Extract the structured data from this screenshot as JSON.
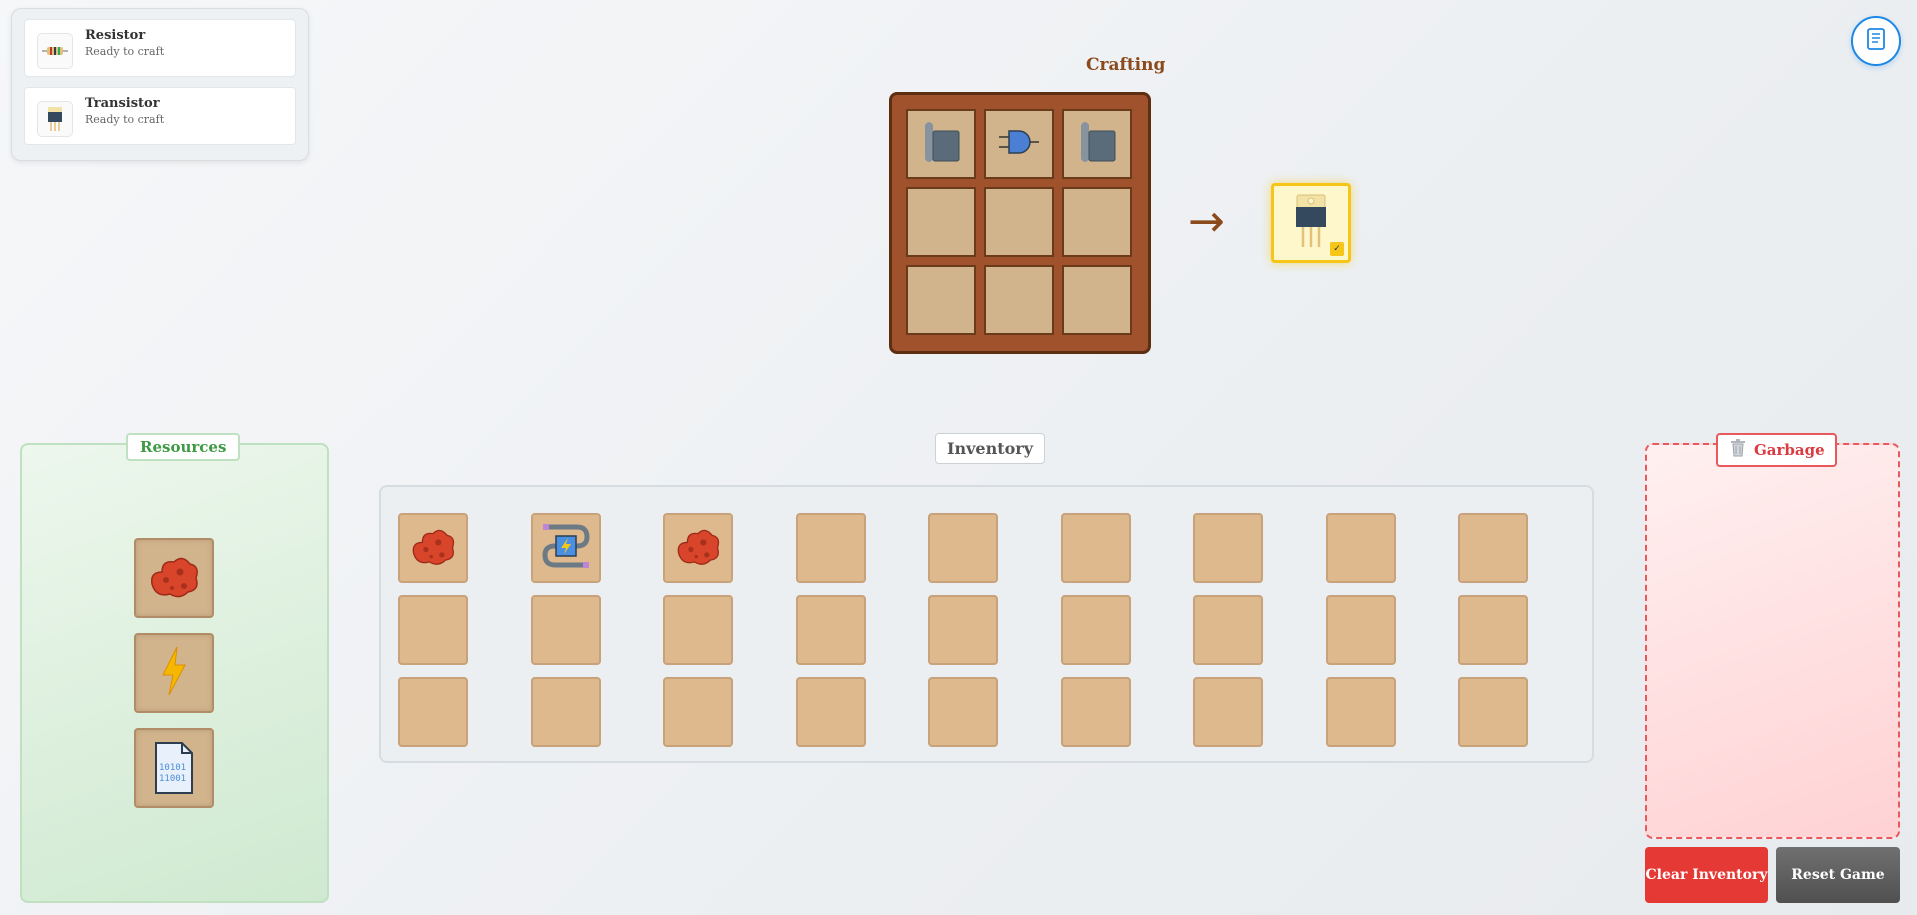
{
  "recipes": [
    {
      "name": "Resistor",
      "status": "Ready to craft",
      "icon": "resistor-icon"
    },
    {
      "name": "Transistor",
      "status": "Ready to craft",
      "icon": "transistor-icon"
    }
  ],
  "crafting": {
    "title": "Crafting",
    "grid": [
      "wafer-icon",
      "and-gate-icon",
      "wafer-icon",
      "",
      "",
      "",
      "",
      "",
      ""
    ],
    "arrow": "→",
    "output": "transistor-icon",
    "output_badge": "✓"
  },
  "resources": {
    "label": "Resources",
    "items": [
      "copper-ore-icon",
      "lightning-icon",
      "binary-file-icon"
    ],
    "file_text_line1": "10101",
    "file_text_line2": "11001"
  },
  "inventory": {
    "label": "Inventory",
    "slots": [
      "copper-ore-icon",
      "power-wire-icon",
      "copper-ore-icon",
      "",
      "",
      "",
      "",
      "",
      "",
      "",
      "",
      "",
      "",
      "",
      "",
      "",
      "",
      "",
      "",
      "",
      "",
      "",
      "",
      "",
      "",
      "",
      ""
    ]
  },
  "garbage": {
    "label": "Garbage",
    "icon": "trash-icon"
  },
  "buttons": {
    "clear": "Clear Inventory",
    "reset": "Reset Game"
  },
  "book_button": {
    "icon": "book-icon"
  }
}
